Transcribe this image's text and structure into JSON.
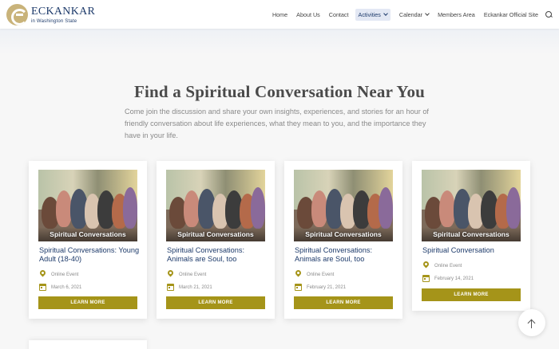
{
  "header": {
    "logo_name": "ECKANKAR",
    "logo_sub": "in Washington State",
    "nav": [
      {
        "label": "Home"
      },
      {
        "label": "About Us"
      },
      {
        "label": "Contact"
      },
      {
        "label": "Activities",
        "active": true,
        "dropdown": true
      },
      {
        "label": "Calendar",
        "dropdown": true
      },
      {
        "label": "Members Area"
      },
      {
        "label": "Eckankar Official Site"
      }
    ]
  },
  "main": {
    "title": "Find a Spiritual Conversation Near You",
    "intro": "Come join the discussion and share your own insights, experiences, and stories for an hour of friendly conversation about life experiences, what they mean to you, and the importance they have in your life."
  },
  "cards": [
    {
      "image_caption": "Spiritual Conversations",
      "title": "Spiritual Conversations: Young Adult (18-40)",
      "location": "Online Event",
      "date": "March 6, 2021",
      "button": "LEARN MORE"
    },
    {
      "image_caption": "Spiritual Conversations",
      "title": "Spiritual Conversations: Animals are Soul, too",
      "location": "Online Event",
      "date": "March 21, 2021",
      "button": "LEARN MORE"
    },
    {
      "image_caption": "Spiritual Conversations",
      "title": "Spiritual Conversations: Animals are Soul, too",
      "location": "Online Event",
      "date": "February 21, 2021",
      "button": "LEARN MORE"
    },
    {
      "image_caption": "Spiritual Conversations",
      "title": "Spiritual Conversation",
      "location": "Online Event",
      "date": "February 14, 2021",
      "button": "LEARN MORE"
    }
  ],
  "colors": {
    "accent": "#a59419",
    "brand": "#1e3b6b"
  }
}
